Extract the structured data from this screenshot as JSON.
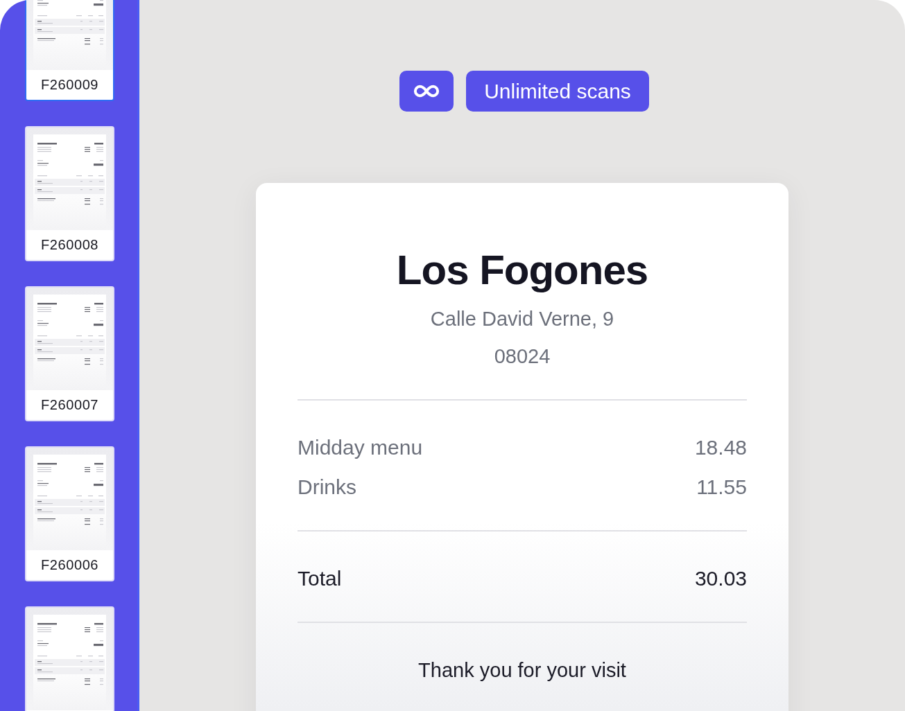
{
  "sidebar": {
    "documents": [
      {
        "number": "F260009",
        "selected": true
      },
      {
        "number": "F260008",
        "selected": false
      },
      {
        "number": "F260007",
        "selected": false
      },
      {
        "number": "F260006",
        "selected": false
      },
      {
        "selected": false
      }
    ]
  },
  "plan": {
    "label": "Unlimited scans"
  },
  "receipt": {
    "merchant": "Los Fogones",
    "address_lines": [
      "Calle David Verne, 9",
      "08024"
    ],
    "items": [
      {
        "name": "Midday menu",
        "amount": "18.48"
      },
      {
        "name": "Drinks",
        "amount": "11.55"
      }
    ],
    "total": {
      "label": "Total",
      "amount": "30.03"
    },
    "footer": "Thank you for your visit"
  }
}
